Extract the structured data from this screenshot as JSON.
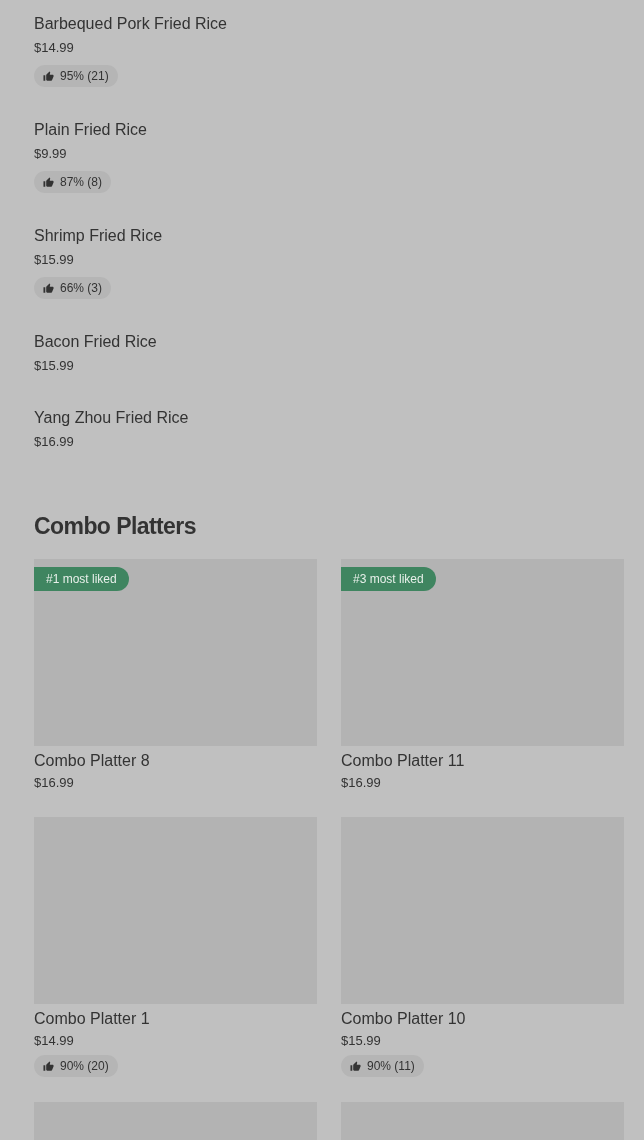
{
  "items": [
    {
      "name": "Barbequed Pork Fried Rice",
      "price": "$14.99",
      "rating": "95% (21)"
    },
    {
      "name": "Plain Fried Rice",
      "price": "$9.99",
      "rating": "87% (8)"
    },
    {
      "name": "Shrimp Fried Rice",
      "price": "$15.99",
      "rating": "66% (3)"
    },
    {
      "name": "Bacon Fried Rice",
      "price": "$15.99"
    },
    {
      "name": "Yang Zhou Fried Rice",
      "price": "$16.99"
    }
  ],
  "section": {
    "title": "Combo Platters",
    "cards": [
      {
        "kind": "full",
        "badge": "#1 most liked",
        "name": "Combo Platter 8",
        "price": "$16.99"
      },
      {
        "kind": "full",
        "badge": "#3 most liked",
        "name": "Combo Platter 11",
        "price": "$16.99"
      },
      {
        "kind": "full",
        "name": "Combo Platter 1",
        "price": "$14.99",
        "rating": "90% (20)"
      },
      {
        "kind": "full",
        "name": "Combo Platter 10",
        "price": "$15.99",
        "rating": "90% (11)"
      },
      {
        "kind": "image_only"
      },
      {
        "kind": "image_only"
      }
    ]
  }
}
